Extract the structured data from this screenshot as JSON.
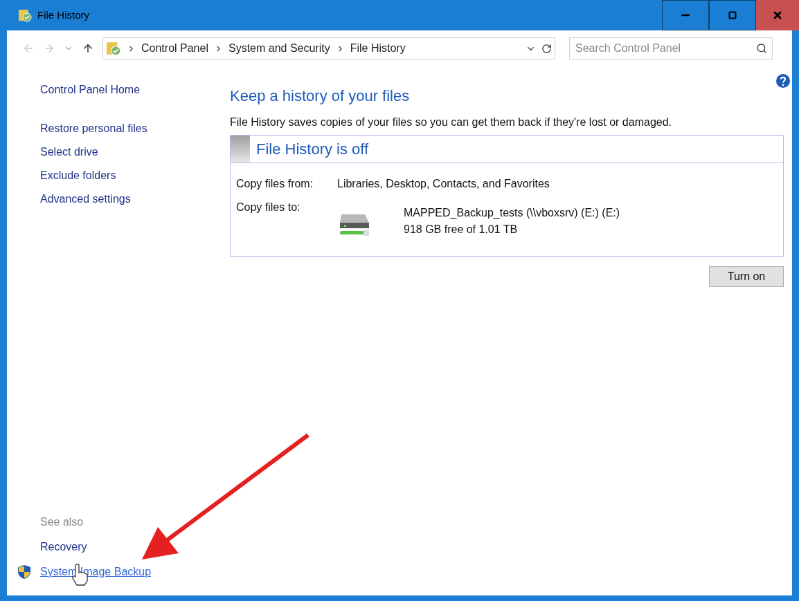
{
  "window": {
    "title": "File History"
  },
  "address_bar": {
    "breadcrumbs": [
      "Control Panel",
      "System and Security",
      "File History"
    ]
  },
  "search": {
    "placeholder": "Search Control Panel"
  },
  "sidebar": {
    "links": [
      "Control Panel Home",
      "Restore personal files",
      "Select drive",
      "Exclude folders",
      "Advanced settings"
    ],
    "see_also": {
      "heading": "See also",
      "links": [
        {
          "label": "Recovery",
          "kind": "plain",
          "hovered": false
        },
        {
          "label": "System Image Backup",
          "kind": "shield",
          "hovered": true
        }
      ]
    }
  },
  "main": {
    "heading": "Keep a history of your files",
    "description": "File History saves copies of your files so you can get them back if they're lost or damaged.",
    "status_panel": {
      "title": "File History is off",
      "copy_from_label": "Copy files from:",
      "copy_from_value": "Libraries, Desktop, Contacts, and Favorites",
      "copy_to_label": "Copy files to:",
      "drive_name": "MAPPED_Backup_tests (\\\\vboxsrv) (E:) (E:)",
      "drive_space": "918 GB free of 1.01 TB"
    },
    "button": "Turn on"
  }
}
